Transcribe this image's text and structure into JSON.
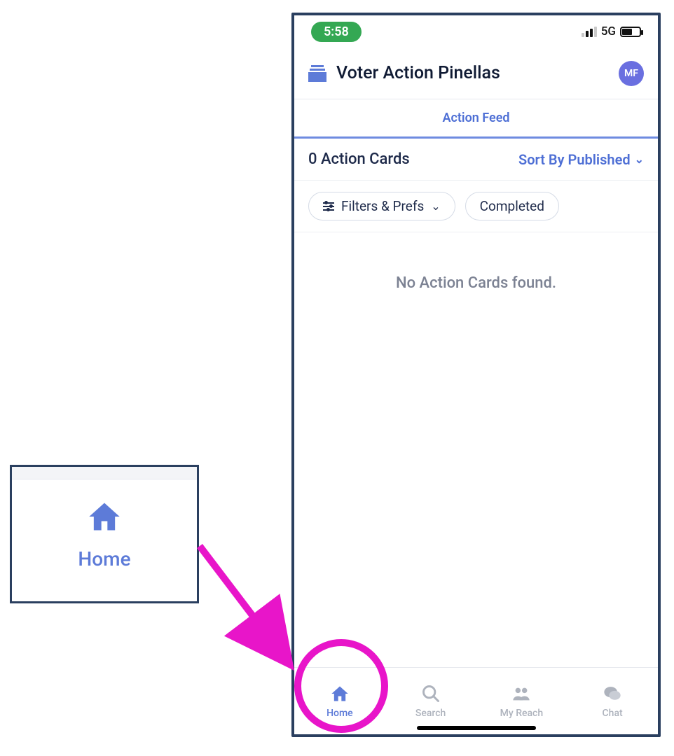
{
  "status_bar": {
    "time": "5:58",
    "network": "5G"
  },
  "header": {
    "title": "Voter Action Pinellas",
    "avatar_initials": "MF"
  },
  "tab": {
    "label": "Action Feed"
  },
  "count_row": {
    "count_text": "0 Action Cards",
    "sort_label": "Sort By Published"
  },
  "chips": {
    "filters_label": "Filters & Prefs",
    "completed_label": "Completed"
  },
  "empty_state": {
    "message": "No Action Cards found."
  },
  "bottom_nav": {
    "items": [
      {
        "label": "Home"
      },
      {
        "label": "Search"
      },
      {
        "label": "My Reach"
      },
      {
        "label": "Chat"
      }
    ]
  },
  "callout": {
    "label": "Home"
  }
}
